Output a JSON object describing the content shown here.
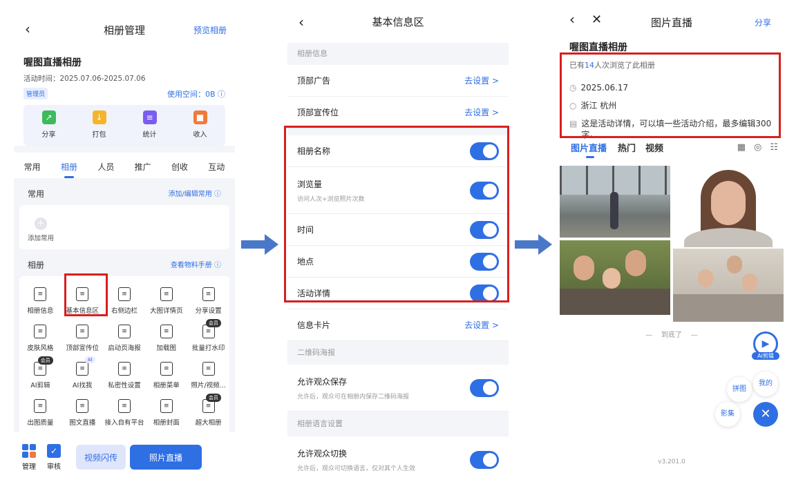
{
  "watermark": "喔图",
  "panel1": {
    "title": "相册管理",
    "preview": "预览相册",
    "album_name": "喔图直播相册",
    "activity_time": "活动时间：2025.07.06-2025.07.06",
    "role_badge": "管理员",
    "space_used": "使用空间：0B",
    "quick_actions": [
      {
        "label": "分享",
        "color": "#3dbb5c",
        "icon": "share-icon"
      },
      {
        "label": "打包",
        "color": "#f5b52b",
        "icon": "package-icon"
      },
      {
        "label": "统计",
        "color": "#7a5cf0",
        "icon": "stats-icon"
      },
      {
        "label": "收入",
        "color": "#f07a3a",
        "icon": "income-icon"
      }
    ],
    "tabs": [
      "常用",
      "相册",
      "人员",
      "推广",
      "创收",
      "互动"
    ],
    "active_tab": "相册",
    "common_section": {
      "title": "常用",
      "link": "添加/编辑常用",
      "add_label": "添加常用"
    },
    "album_section": {
      "title": "相册",
      "link": "查看物料手册"
    },
    "grid_items": [
      {
        "label": "相册信息",
        "tag": ""
      },
      {
        "label": "基本信息区",
        "tag": ""
      },
      {
        "label": "右侧边栏",
        "tag": ""
      },
      {
        "label": "大图详情页",
        "tag": ""
      },
      {
        "label": "分享设置",
        "tag": ""
      },
      {
        "label": "皮肤风格",
        "tag": ""
      },
      {
        "label": "顶部宣传位",
        "tag": ""
      },
      {
        "label": "启动页海报",
        "tag": ""
      },
      {
        "label": "加载图",
        "tag": ""
      },
      {
        "label": "批量打水印",
        "tag": "会员"
      },
      {
        "label": "AI剪辑",
        "tag": "会员"
      },
      {
        "label": "AI找我",
        "tag": "AI"
      },
      {
        "label": "私密性设置",
        "tag": ""
      },
      {
        "label": "相册菜单",
        "tag": ""
      },
      {
        "label": "照片/视频...",
        "tag": ""
      },
      {
        "label": "出图质量",
        "tag": ""
      },
      {
        "label": "图文直播",
        "tag": ""
      },
      {
        "label": "接入自有平台",
        "tag": ""
      },
      {
        "label": "相册封面",
        "tag": ""
      },
      {
        "label": "超大相册",
        "tag": "会员"
      }
    ],
    "bottom": {
      "manage": "管理",
      "review": "审核",
      "video_flash": "视频闪传",
      "photo_live": "照片直播"
    }
  },
  "panel2": {
    "title": "基本信息区",
    "group_album_info": "相册信息",
    "top_ad": "顶部广告",
    "top_promo": "顶部宣传位",
    "go_set": "去设置 >",
    "album_name": "相册名称",
    "views": "浏览量",
    "views_sub": "访问人次+浏览照片次数",
    "time": "时间",
    "location": "地点",
    "details": "活动详情",
    "info_card": "信息卡片",
    "group_qr": "二维码海报",
    "allow_save": "允许观众保存",
    "allow_save_sub": "允许后，观众可在相册内保存二维码海报",
    "group_lang": "相册语言设置",
    "allow_switch": "允许观众切换",
    "allow_switch_sub": "允许后，观众可切换语言，仅对其个人生效",
    "toggles": {
      "album_name": true,
      "views": true,
      "time": true,
      "location": true,
      "details": true,
      "allow_save": true,
      "allow_switch": true
    }
  },
  "panel3": {
    "title": "图片直播",
    "share": "分享",
    "album_name": "喔图直播相册",
    "views_prefix": "已有",
    "views_count": "14",
    "views_suffix": "人次浏览了此相册",
    "date": "2025.06.17",
    "location": "浙江 杭州",
    "details": "这是活动详情，可以填一些活动介绍，最多编辑300字。",
    "tabs": [
      "图片直播",
      "热门",
      "视频"
    ],
    "end_text": "到底了",
    "ai_clip": "AI剪辑",
    "mine": "我的",
    "collage": "拼图",
    "movie": "影集",
    "version": "v3.201.0"
  }
}
